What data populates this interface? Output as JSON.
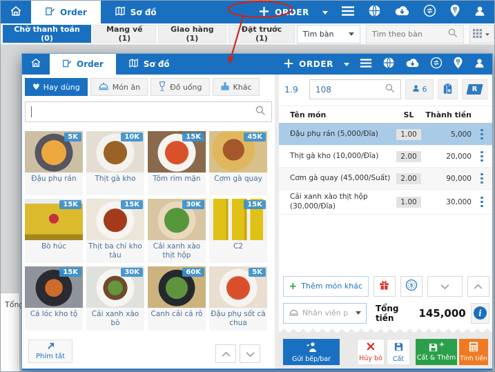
{
  "colors": {
    "accent": "#1a70c0",
    "selected_row": "#a9cbe8",
    "badge_blue": "#3b90ce",
    "green": "#2ba04a",
    "orange": "#ee7b23",
    "red": "#da3025",
    "annotation_red": "#c5271d"
  },
  "icons": {
    "heart_glyph": "♥",
    "coin_glyph": "$",
    "info_glyph": "i",
    "add_plus_glyph": "+",
    "save_add_plus_glyph": "+"
  },
  "header": {
    "tab_order": "Order",
    "tab_map": "Sơ đồ",
    "new_order": "ORDER"
  },
  "filter_bar": {
    "filters": [
      {
        "label": "Chờ thanh toán (0)",
        "active": true
      },
      {
        "label": "Mang về (1)"
      },
      {
        "label": "Giao hàng (1)"
      },
      {
        "label": "Đặt trước (1)"
      }
    ],
    "table_filter": "Tìm bàn",
    "search_placeholder": "Tìm theo bàn"
  },
  "background": {
    "partial_label": "Tổng"
  },
  "popup": {
    "left_panel": {
      "categories": [
        {
          "label": "Hay dùng",
          "active": true
        },
        {
          "label": "Món ăn"
        },
        {
          "label": "Đồ uống"
        },
        {
          "label": "Khác"
        }
      ],
      "search_value": "",
      "items": [
        {
          "name": "Đậu phụ rán",
          "price": "5K",
          "img": "background:radial-gradient(circle at 50% 52%, #eca93f 0 34%, #565660 35% 52%, #cdbfa4 53%)"
        },
        {
          "name": "Thịt gà kho",
          "price": "10K",
          "img": "background:radial-gradient(circle at 50% 52%, #9a6227 0 32%, #f4f2ee 33% 52%, #e4ded2 53%)"
        },
        {
          "name": "Tôm rim mặn",
          "price": "15K",
          "img": "background:radial-gradient(circle at 50% 52%, #d9512b 0 32%, #f6f4f0 33% 52%, #8a6a4c 53%)"
        },
        {
          "name": "Cơm gà quay",
          "price": "45K",
          "img": "background:radial-gradient(circle at 42% 45%, #a3572a 0 26%, #e0b75e 27% 52%, #d9c08a 53%)"
        },
        {
          "name": "Bò húc",
          "price": "15K",
          "img": "background:radial-gradient(circle at 50% 48%, #c82f3e 0 13%, rgba(0,0,0,0) 14%), linear-gradient(180deg, #e9ecef 0 12%, #dcba2e 12% 86%, #a3861c 86%)"
        },
        {
          "name": "Thịt ba chỉ kho tàu",
          "price": "15K",
          "img": "background:radial-gradient(circle at 50% 52%, #a43a1c 0 32%, #f7f5f1 33% 52%, #ece5da 53%)"
        },
        {
          "name": "Cải xanh xào thịt hộp",
          "price": "30K",
          "img": "background:radial-gradient(circle at 50% 52%, #57973b 0 34%, #ead9bd 35% 52%, #d8c5a1 53%)"
        },
        {
          "name": "C2",
          "price": "15K",
          "img": "background:linear-gradient(90deg, #f2f1ec 0 7%, #e0c116 7% 29%, #c7a70d 29% 33%, #f2f1ec 33% 39%, #e0c116 39% 61%, #c7a70d 61% 65%, #f2f1ec 65% 71%, #e0c116 71% 93%, #f2f1ec 93%)"
        },
        {
          "name": "Cá lóc kho tộ",
          "price": "15K",
          "img": "background:radial-gradient(circle at 50% 52%, #cd6c2a 0 24%, #2a2a31 25% 50%, #8f949c 51%)"
        },
        {
          "name": "Cải xanh xào bò",
          "price": "30K",
          "img": "background:radial-gradient(circle at 50% 52%, #66953d 0 20%, #6e4b2e 21% 33%, #f6f5f2 34% 52%, #dfe2dc 53%)"
        },
        {
          "name": "Canh cải cá rô",
          "price": "60K",
          "img": "background:radial-gradient(circle at 50% 52%, #5e9440 0 30%, #26282e 31% 50%, #ccb37e 51%)"
        },
        {
          "name": "Đậu phụ sốt cà chua",
          "price": "5K",
          "img": "background:radial-gradient(circle at 50% 52%, #da4f2a 0 32%, #f7f4ef 33% 52%, #e9ded0 53%)"
        }
      ],
      "shortcut_label": "Phím tắt"
    },
    "right_panel": {
      "table_number": "1.9",
      "order_code": "108",
      "guest_count": "6",
      "reservation_label": "R",
      "columns": {
        "name": "Tên món",
        "qty": "SL",
        "amount": "Thành tiền"
      },
      "rows": [
        {
          "name": "Đậu phụ rán (5,000/Đĩa)",
          "qty": "1.00",
          "amount": "5,000",
          "selected": true
        },
        {
          "name": "Thịt gà kho (10,000/Đĩa)",
          "qty": "2.00",
          "amount": "20,000"
        },
        {
          "name": "Cơm gà quay (45,000/Suất)",
          "qty": "2.00",
          "amount": "90,000"
        },
        {
          "name": "Cải xanh xào thịt hộp (30,000/Đĩa)",
          "qty": "1.00",
          "amount": "30,000"
        }
      ],
      "add_item_label": "Thêm món khác",
      "staff_placeholder": "Nhân viên p",
      "total_label": "Tổng tiền",
      "total_value": "145,000",
      "footer": {
        "send_kitchen": "Gửi bếp/bar",
        "cancel": "Hủy bỏ",
        "save": "Cất",
        "save_add": "Cất & Thêm",
        "checkout": "Tính tiền"
      }
    }
  }
}
